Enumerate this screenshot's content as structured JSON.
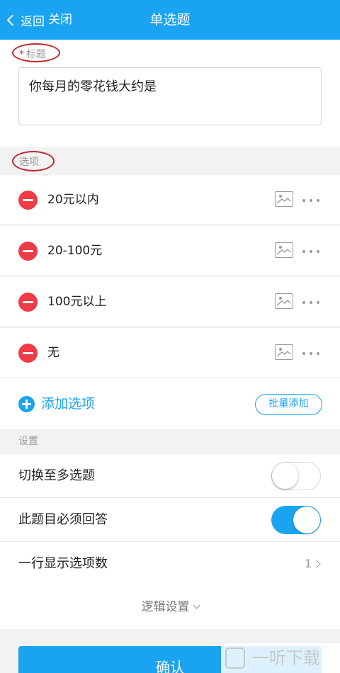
{
  "nav": {
    "back_label": "返回",
    "close_label": "关闭",
    "title": "单选题"
  },
  "title_section": {
    "required_mark": "*",
    "label": "标题",
    "value": "你每月的零花钱大约是"
  },
  "options_section": {
    "label": "选项",
    "items": [
      {
        "label": "20元以内"
      },
      {
        "label": "20-100元"
      },
      {
        "label": "100元以上"
      },
      {
        "label": "无"
      }
    ],
    "add_label": "添加选项",
    "batch_add_label": "批量添加"
  },
  "settings": {
    "label": "设置",
    "switch_multi": {
      "label": "切换至多选题",
      "on": false
    },
    "required": {
      "label": "此题目必须回答",
      "on": true
    },
    "per_row": {
      "label": "一行显示选项数",
      "value": "1"
    },
    "logic_label": "逻辑设置"
  },
  "confirm_label": "确认",
  "watermark": {
    "text": "一听下载"
  },
  "colors": {
    "accent": "#1aa3f0",
    "danger": "#ef3b45",
    "annotation": "#c0272d"
  }
}
